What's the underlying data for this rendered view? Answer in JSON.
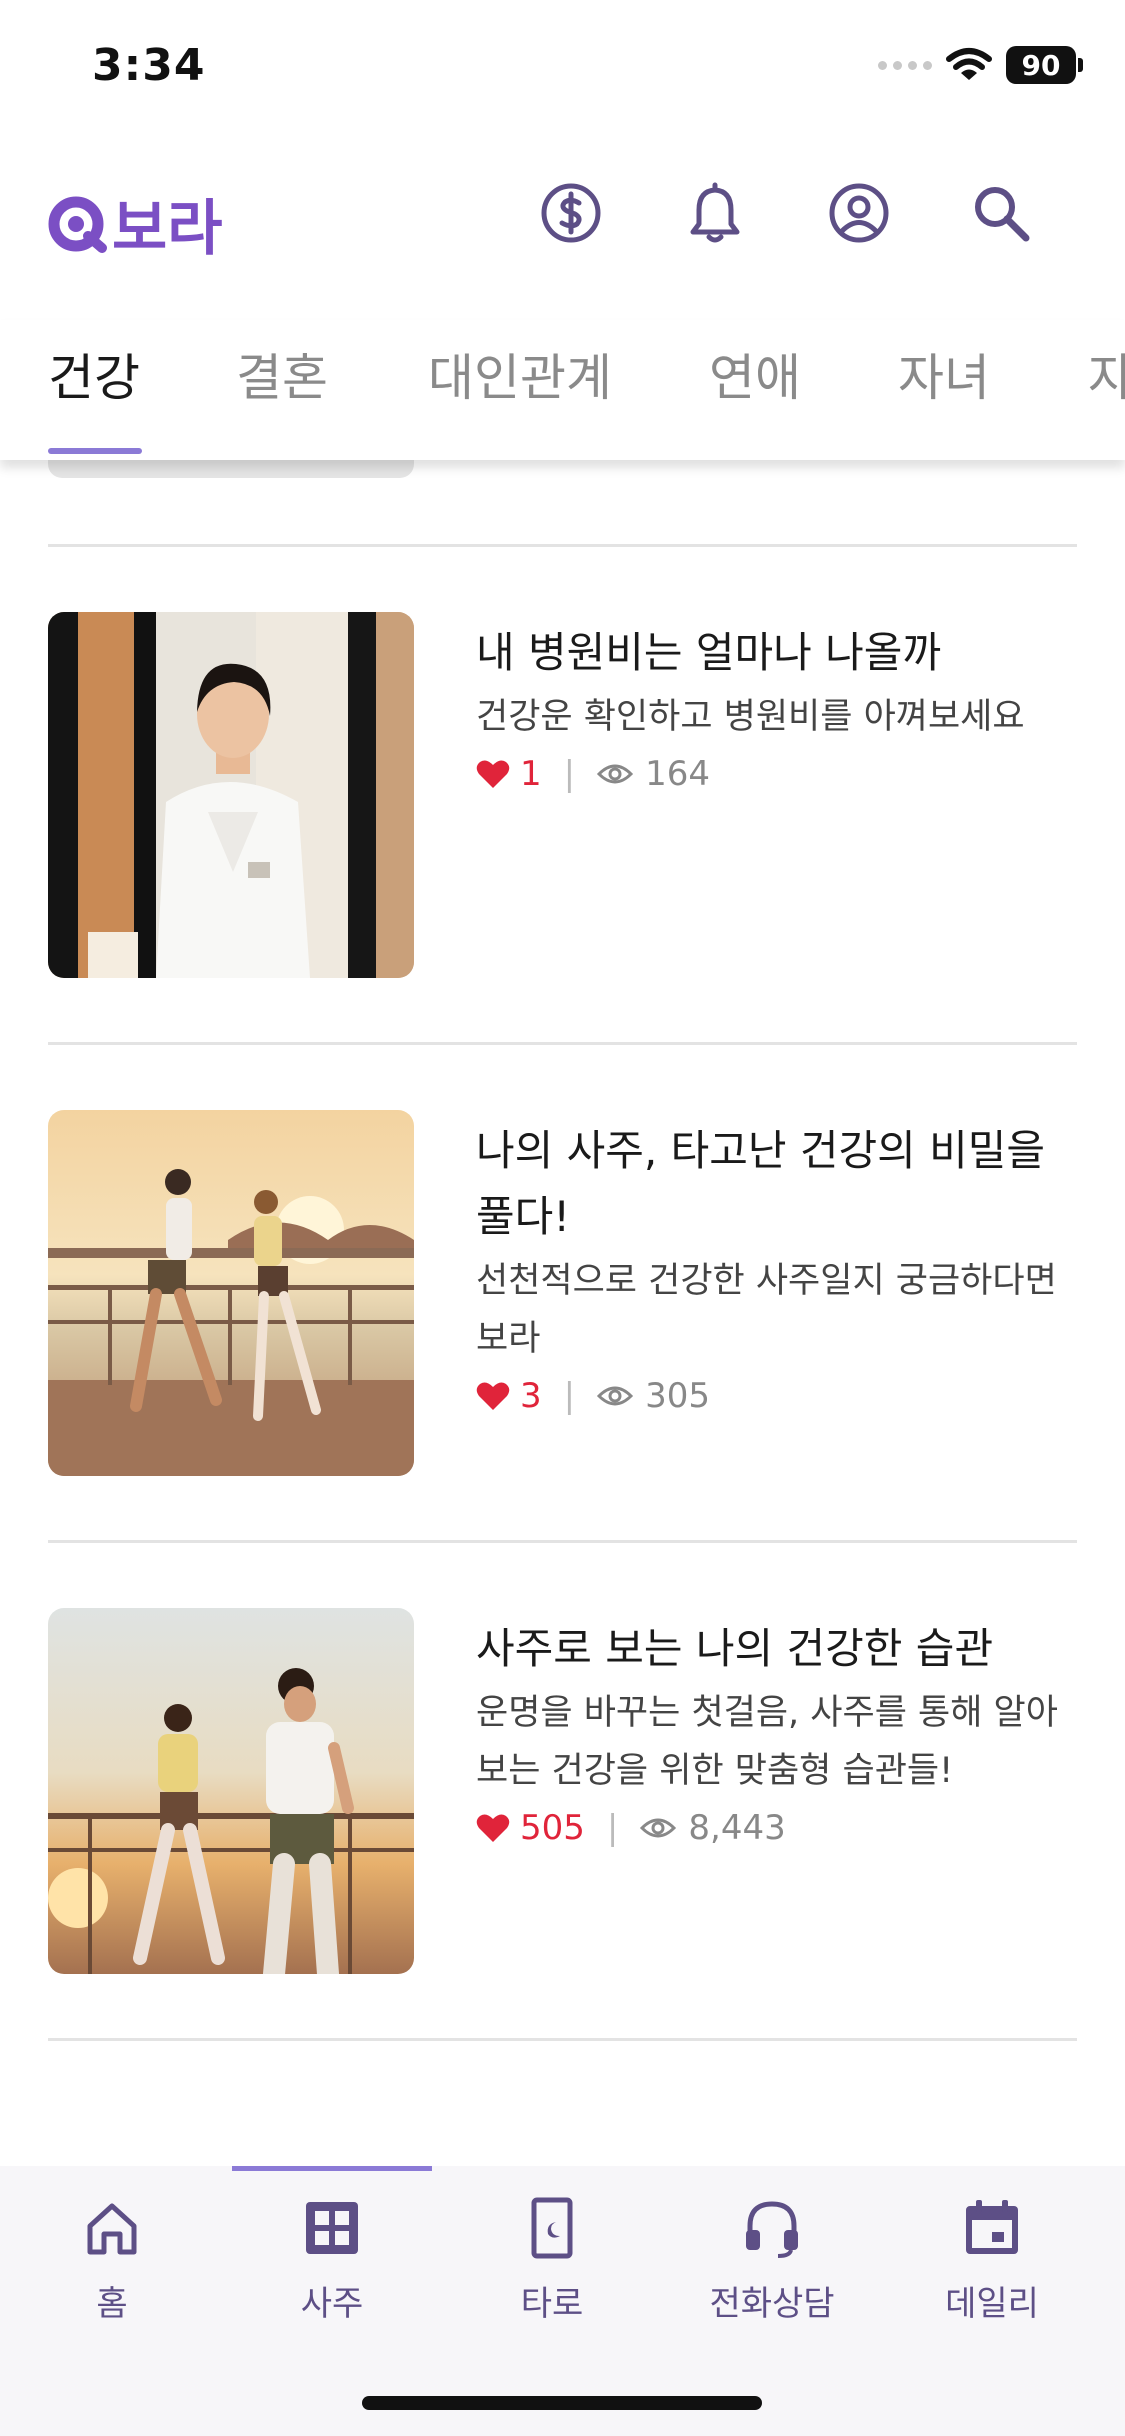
{
  "status_bar": {
    "time": "3:34",
    "battery": "90"
  },
  "header": {
    "logo_text": "보라",
    "icons": [
      "coin-icon",
      "bell-icon",
      "profile-icon",
      "search-icon"
    ]
  },
  "tabs": [
    {
      "label": "건강",
      "active": true
    },
    {
      "label": "결혼",
      "active": false
    },
    {
      "label": "대인관계",
      "active": false
    },
    {
      "label": "연애",
      "active": false
    },
    {
      "label": "자녀",
      "active": false
    },
    {
      "label": "자",
      "active": false
    }
  ],
  "articles": [
    {
      "title": "내 병원비는 얼마나 나올까",
      "desc": "건강운 확인하고 병원비를 아껴보세요",
      "likes": "1",
      "views": "164",
      "image": "doctor-photo"
    },
    {
      "title": "나의 사주, 타고난 건강의 비밀을 풀다!",
      "desc": "선천적으로 건강한 사주일지 궁금하다면 보라",
      "likes": "3",
      "views": "305",
      "image": "jogging-couple-photo"
    },
    {
      "title": "사주로 보는 나의 건강한 습관",
      "desc": "운명을 바꾸는 첫걸음, 사주를 통해 알아보는 건강을 위한 맞춤형 습관들!",
      "likes": "505",
      "views": "8,443",
      "image": "running-couple-photo"
    }
  ],
  "bottom_nav": [
    {
      "label": "홈",
      "icon": "home-icon",
      "active": false
    },
    {
      "label": "사주",
      "icon": "grid-icon",
      "active": true
    },
    {
      "label": "타로",
      "icon": "tarot-card-icon",
      "active": false
    },
    {
      "label": "전화상담",
      "icon": "headset-icon",
      "active": false
    },
    {
      "label": "데일리",
      "icon": "calendar-icon",
      "active": false
    }
  ],
  "colors": {
    "brand": "#7b4fc4",
    "icon": "#5d4f86",
    "tab_indicator": "#8b7ad6",
    "like": "#e0243a"
  }
}
